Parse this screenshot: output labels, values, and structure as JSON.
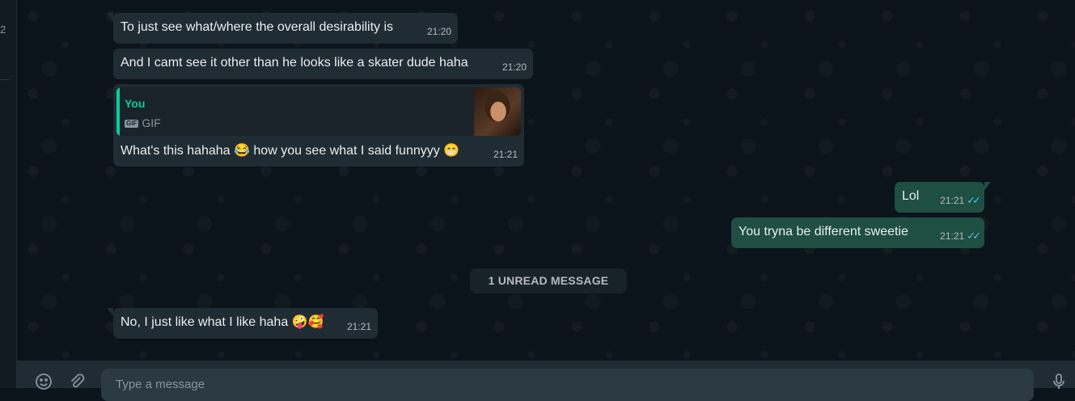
{
  "sidebar": {
    "fragment_digit": "2"
  },
  "messages": [
    {
      "direction": "in",
      "text": "To just see what/where the overall desirability is",
      "time": "21:20"
    },
    {
      "direction": "in",
      "text": "And I camt see it other than he looks like a skater dude haha",
      "time": "21:20"
    },
    {
      "direction": "in",
      "quote": {
        "author": "You",
        "type_label": "GIF",
        "icon": "gif-icon"
      },
      "text": "What's this hahaha 😂 how you see what I said funnyyy 😁",
      "time": "21:21"
    },
    {
      "direction": "out",
      "text": "Lol",
      "time": "21:21",
      "status": "read"
    },
    {
      "direction": "out",
      "text": "You tryna be different sweetie",
      "time": "21:21",
      "status": "read"
    },
    {
      "direction": "in",
      "text": "No, I just like what I like haha 🤪🥰",
      "time": "21:21"
    }
  ],
  "unread_divider": "1 UNREAD MESSAGE",
  "composer": {
    "placeholder": "Type a message",
    "icons": [
      "emoji-icon",
      "attach-icon",
      "microphone-icon"
    ]
  },
  "colors": {
    "background": "#0b141a",
    "incoming_bubble": "#202c33",
    "outgoing_bubble": "#1f4e43",
    "accent": "#06cf9c",
    "read_tick": "#53bdeb"
  }
}
